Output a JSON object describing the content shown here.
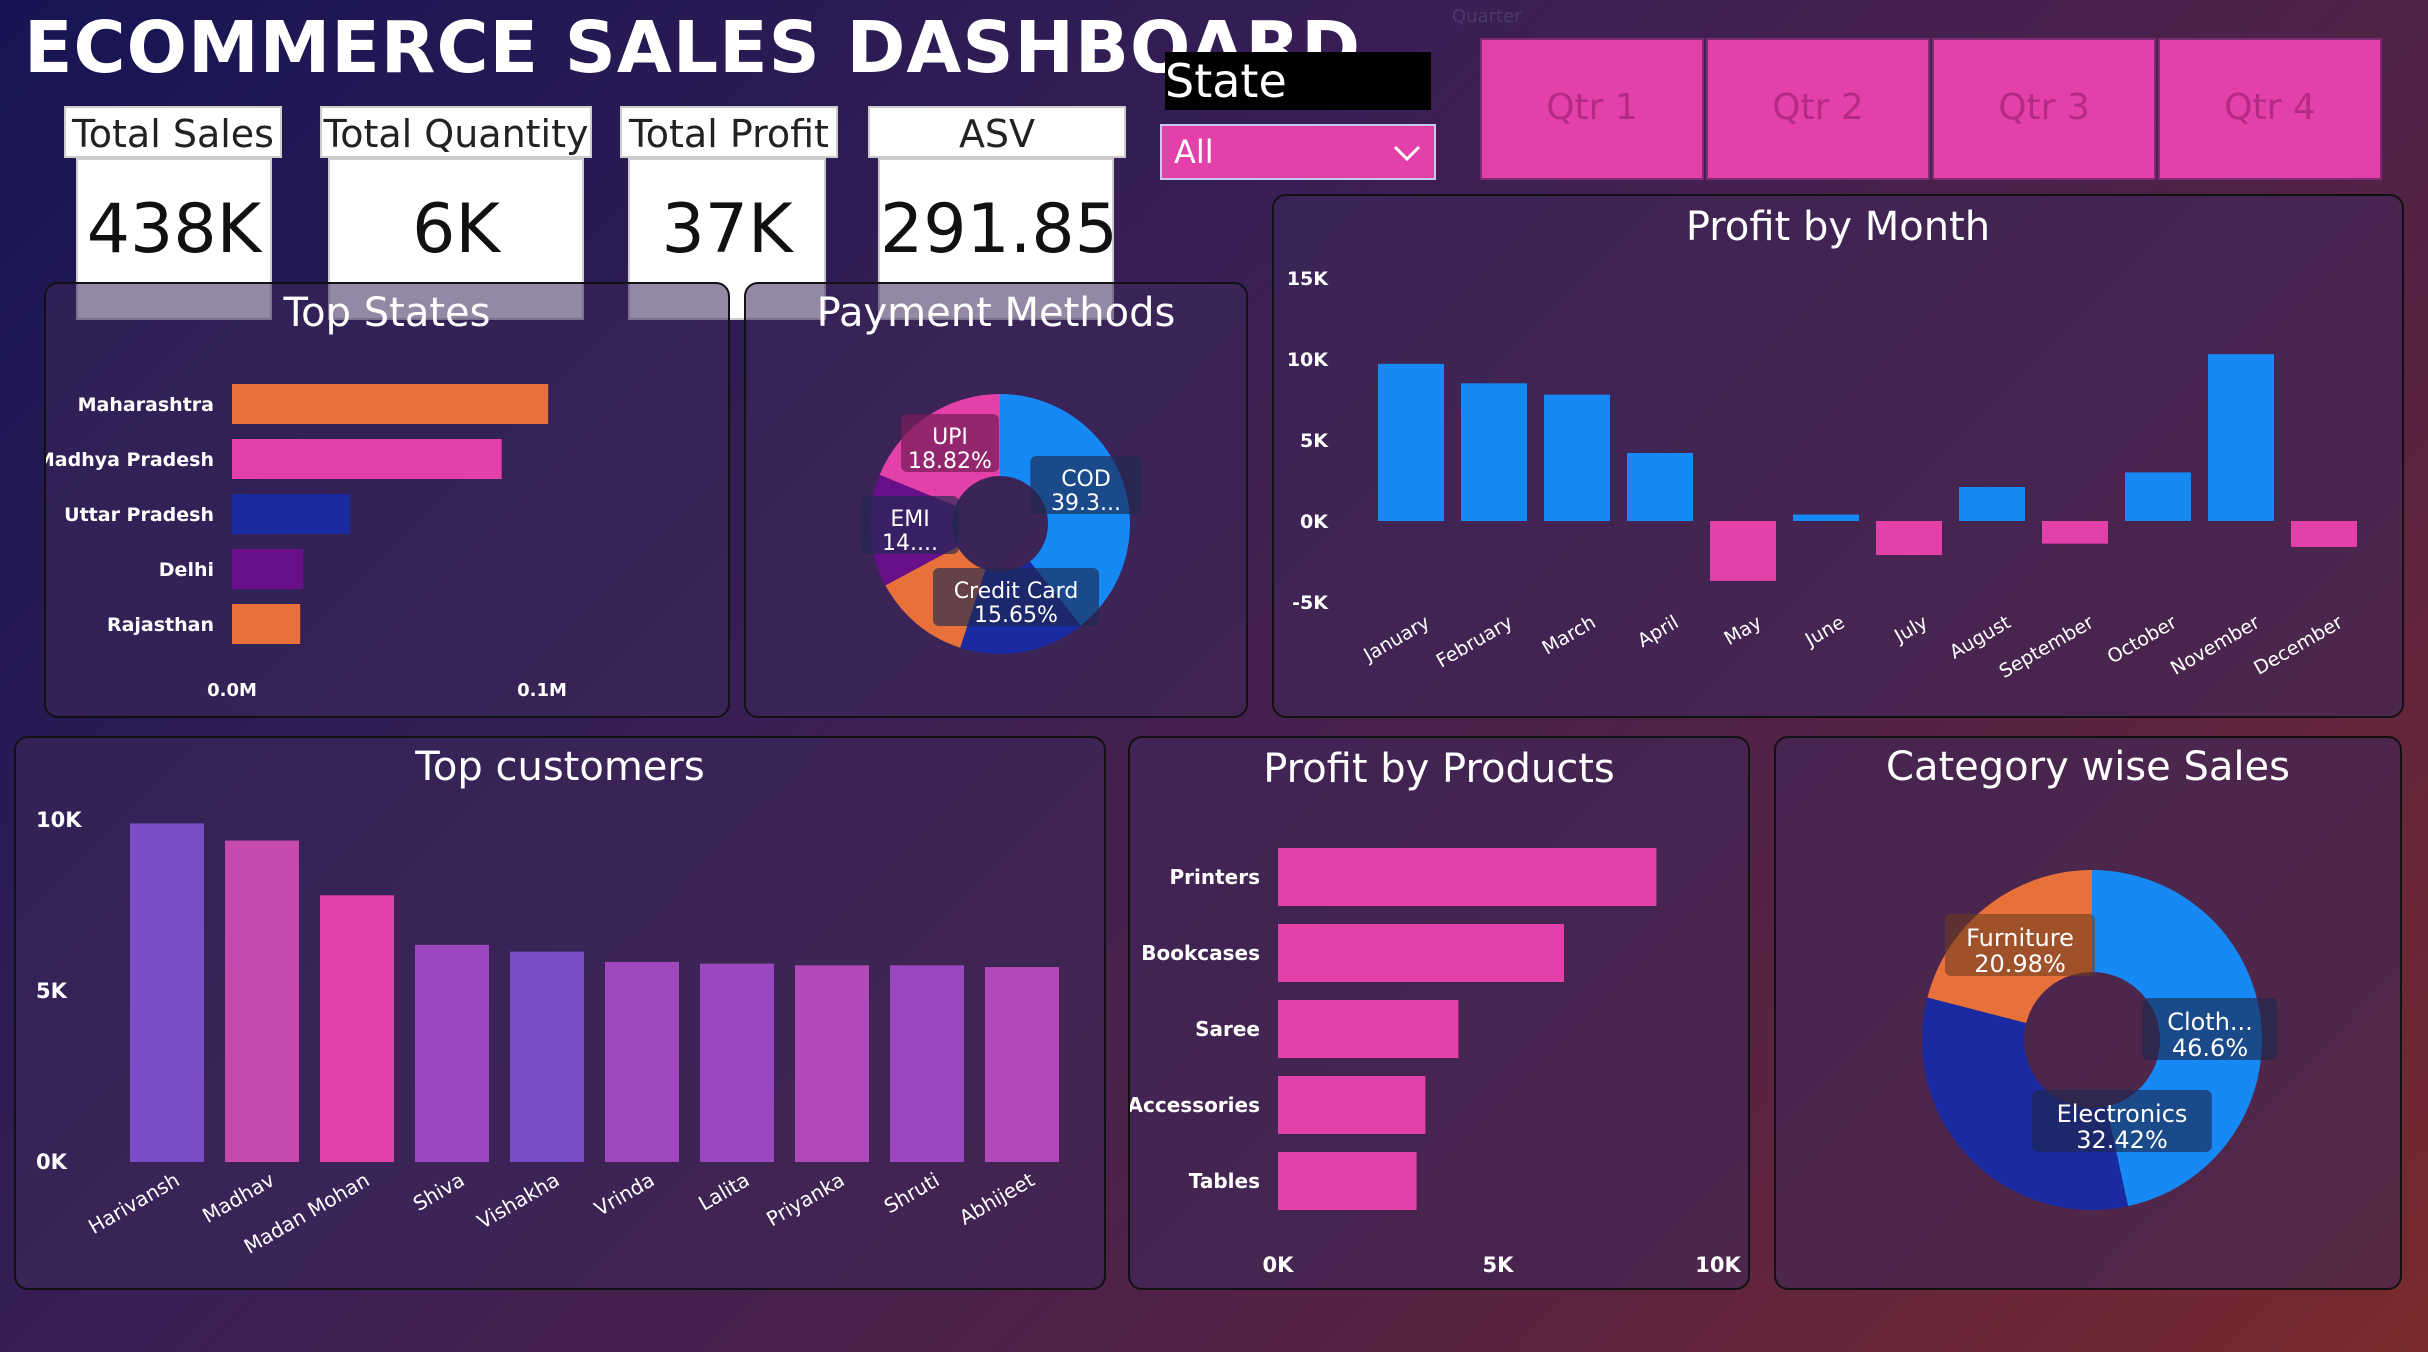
{
  "title": "ECOMMERCE SALES DASHBOARD",
  "kpis": [
    {
      "label": "Total Sales",
      "value": "438K"
    },
    {
      "label": "Total Quantity",
      "value": "6K"
    },
    {
      "label": "Total Profit",
      "value": "37K"
    },
    {
      "label": "ASV",
      "value": "291.85"
    }
  ],
  "state_filter": {
    "label": "State",
    "value": "All"
  },
  "quarter_filter": {
    "label": "Quarter",
    "buttons": [
      "Qtr 1",
      "Qtr 2",
      "Qtr 3",
      "Qtr 4"
    ]
  },
  "colors": {
    "orange": "#e8703a",
    "pink": "#e340a9",
    "navy": "#1a2aa0",
    "purple": "#6a0f8a",
    "blue": "#1689f5",
    "violet": "#7a4cc7",
    "magenta": "#b04ab8"
  },
  "chart_data": [
    {
      "id": "top_states",
      "type": "bar",
      "orientation": "horizontal",
      "title": "Top States",
      "categories": [
        "Maharashtra",
        "Madhya Pradesh",
        "Uttar Pradesh",
        "Delhi",
        "Rajasthan"
      ],
      "values": [
        0.102,
        0.087,
        0.038,
        0.023,
        0.022
      ],
      "colors": [
        "#e8703a",
        "#e340a9",
        "#1a2aa0",
        "#6a0f8a",
        "#e8703a"
      ],
      "xlim": [
        0,
        0.1
      ],
      "xticks": [
        "0.0M",
        "0.1M"
      ]
    },
    {
      "id": "payment_methods",
      "type": "pie",
      "title": "Payment Methods",
      "slices": [
        {
          "label": "COD",
          "pct_text": "39.3...",
          "value": 39.3,
          "color": "#1689f5"
        },
        {
          "label": "Credit Card",
          "pct_text": "15.65%",
          "value": 15.65,
          "color": "#1a2aa0"
        },
        {
          "label": "",
          "pct_text": "",
          "value": 12.23,
          "color": "#e8703a"
        },
        {
          "label": "EMI",
          "pct_text": "14....",
          "value": 14.0,
          "color": "#6a0f8a"
        },
        {
          "label": "UPI",
          "pct_text": "18.82%",
          "value": 18.82,
          "color": "#e340a9"
        }
      ]
    },
    {
      "id": "profit_by_month",
      "type": "bar",
      "title": "Profit by Month",
      "categories": [
        "January",
        "February",
        "March",
        "April",
        "May",
        "June",
        "July",
        "August",
        "September",
        "October",
        "November",
        "December"
      ],
      "values": [
        9700,
        8500,
        7800,
        4200,
        -3700,
        400,
        -2100,
        2100,
        -1400,
        3000,
        10300,
        -1600
      ],
      "ylim": [
        -5000,
        15000
      ],
      "yticks": [
        "-5K",
        "0K",
        "5K",
        "10K",
        "15K"
      ],
      "positive_color": "#1689f5",
      "negative_color": "#e340a9"
    },
    {
      "id": "top_customers",
      "type": "bar",
      "title": "Top customers",
      "categories": [
        "Harivansh",
        "Madhav",
        "Madan Mohan",
        "Shiva",
        "Vishakha",
        "Vrinda",
        "Lalita",
        "Priyanka",
        "Shruti",
        "Abhijeet"
      ],
      "values": [
        9900,
        9400,
        7800,
        6350,
        6150,
        5850,
        5800,
        5750,
        5750,
        5700
      ],
      "colors": [
        "#7a4cc7",
        "#c64aae",
        "#e340a9",
        "#9b48c0",
        "#7a4cc7",
        "#a049bd",
        "#9b48c0",
        "#b04ab8",
        "#9b48c0",
        "#b04ab8"
      ],
      "ylim": [
        0,
        10000
      ],
      "yticks": [
        "0K",
        "5K",
        "10K"
      ]
    },
    {
      "id": "profit_by_products",
      "type": "bar",
      "orientation": "horizontal",
      "title": "Profit by Products",
      "categories": [
        "Printers",
        "Bookcases",
        "Saree",
        "Accessories",
        "Tables"
      ],
      "values": [
        8600,
        6500,
        4100,
        3350,
        3150
      ],
      "color": "#e340a9",
      "xlim": [
        0,
        10000
      ],
      "xticks": [
        "0K",
        "5K",
        "10K"
      ]
    },
    {
      "id": "category_wise_sales",
      "type": "pie",
      "title": "Category wise Sales",
      "slices": [
        {
          "label": "Cloth...",
          "pct_text": "46.6%",
          "value": 46.6,
          "color": "#1689f5"
        },
        {
          "label": "Electronics",
          "pct_text": "32.42%",
          "value": 32.42,
          "color": "#1a2aa0"
        },
        {
          "label": "Furniture",
          "pct_text": "20.98%",
          "value": 20.98,
          "color": "#e8703a"
        }
      ]
    }
  ]
}
